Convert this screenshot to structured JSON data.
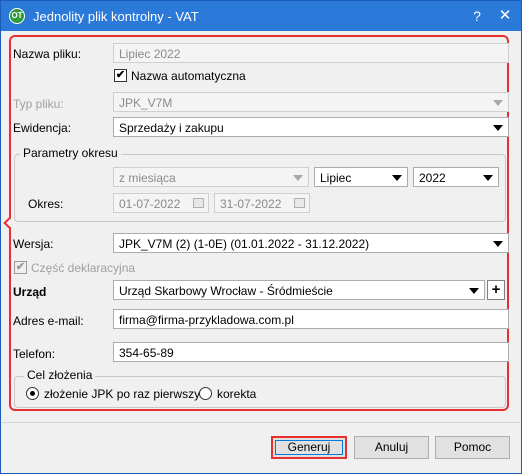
{
  "window": {
    "title": "Jednolity plik kontrolny - VAT",
    "help_label": "?",
    "close_label": "✕",
    "icon_text": "OT"
  },
  "form": {
    "nazwa_pliku_label": "Nazwa pliku:",
    "nazwa_pliku_value": "Lipiec 2022",
    "nazwa_auto_label": "Nazwa automatyczna",
    "nazwa_auto_checked": "✔",
    "typ_pliku_label": "Typ pliku:",
    "typ_pliku_value": "JPK_V7M",
    "ewidencja_label": "Ewidencja:",
    "ewidencja_value": "Sprzedaży i zakupu",
    "parametry_label": "Parametry okresu",
    "okres_typ_value": "z miesiąca",
    "miesiac_value": "Lipiec",
    "rok_value": "2022",
    "okres_label": "Okres:",
    "okres_od": "01-07-2022",
    "okres_do": "31-07-2022",
    "wersja_label": "Wersja:",
    "wersja_value": "JPK_V7M (2) (1-0E) (01.01.2022 - 31.12.2022)",
    "czesc_label": "Część deklaracyjna",
    "czesc_checked": "✔",
    "urzad_label": "Urząd",
    "urzad_value": "Urząd Skarbowy Wrocław - Śródmieście",
    "urzad_add": "+",
    "email_label": "Adres e-mail:",
    "email_value": "firma@firma-przykladowa.com.pl",
    "telefon_label": "Telefon:",
    "telefon_value": "354-65-89",
    "cel_label": "Cel złożenia",
    "cel_option1": "złożenie JPK po raz pierwszy",
    "cel_option2": "korekta",
    "cel_selected": "złożenie JPK po raz pierwszy"
  },
  "buttons": {
    "generuj": "Generuj",
    "anuluj": "Anuluj",
    "pomoc": "Pomoc"
  },
  "colors": {
    "titlebar": "#2b79d8",
    "highlight": "#e83030"
  }
}
